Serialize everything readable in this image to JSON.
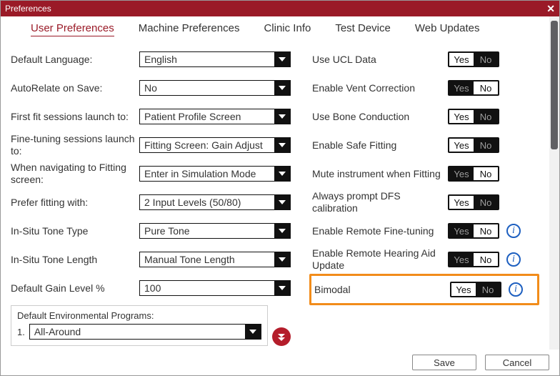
{
  "window": {
    "title": "Preferences"
  },
  "tabs": {
    "items": [
      {
        "label": "User Preferences",
        "active": true
      },
      {
        "label": "Machine Preferences"
      },
      {
        "label": "Clinic Info"
      },
      {
        "label": "Test Device"
      },
      {
        "label": "Web Updates"
      }
    ]
  },
  "left": {
    "default_language": {
      "label": "Default Language:",
      "value": "English"
    },
    "autorelate": {
      "label": "AutoRelate on Save:",
      "value": "No"
    },
    "first_fit": {
      "label": "First fit sessions launch to:",
      "value": "Patient Profile Screen"
    },
    "fine_tuning": {
      "label": "Fine-tuning sessions launch to:",
      "value": "Fitting Screen:  Gain Adjust"
    },
    "navigating": {
      "label": "When navigating to Fitting screen:",
      "value": "Enter in Simulation Mode"
    },
    "prefer_fitting": {
      "label": "Prefer fitting with:",
      "value": "2 Input Levels (50/80)"
    },
    "tone_type": {
      "label": "In-Situ Tone Type",
      "value": "Pure Tone"
    },
    "tone_length": {
      "label": "In-Situ Tone Length",
      "value": "Manual Tone Length"
    },
    "gain_level": {
      "label": "Default Gain Level %",
      "value": "100"
    },
    "env": {
      "title": "Default Environmental Programs:",
      "index": "1.",
      "value": "All-Around"
    }
  },
  "right": {
    "yes": "Yes",
    "no": "No",
    "ucl": {
      "label": "Use UCL Data",
      "value": "Yes"
    },
    "vent": {
      "label": "Enable Vent Correction",
      "value": "No"
    },
    "bone": {
      "label": "Use Bone Conduction",
      "value": "Yes"
    },
    "safe": {
      "label": "Enable Safe Fitting",
      "value": "Yes"
    },
    "mute": {
      "label": "Mute instrument when Fitting",
      "value": "No"
    },
    "dfs": {
      "label": "Always prompt DFS calibration",
      "value": "Yes"
    },
    "remote_ft": {
      "label": "Enable Remote Fine-tuning",
      "value": "No",
      "info": true
    },
    "remote_ha": {
      "label": "Enable Remote Hearing Aid Update",
      "value": "No",
      "info": true
    },
    "bimodal": {
      "label": "Bimodal",
      "value": "Yes",
      "info": true,
      "highlight": true
    }
  },
  "footer": {
    "save": "Save",
    "cancel": "Cancel"
  }
}
